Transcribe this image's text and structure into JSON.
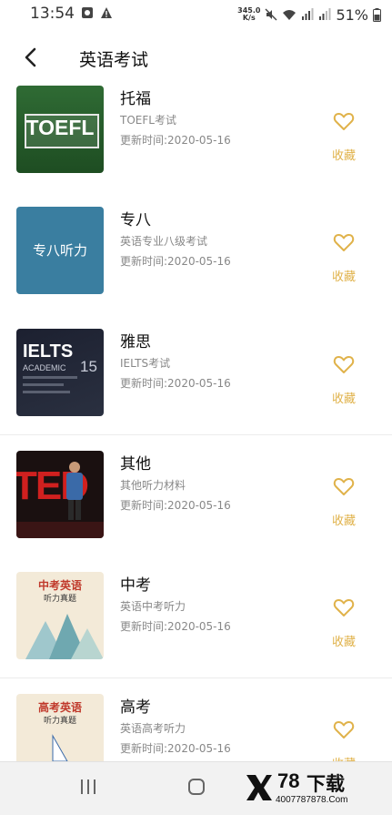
{
  "status_bar": {
    "time": "13:54",
    "net_speed_value": "345.0",
    "net_speed_unit": "K/s",
    "battery": "51%"
  },
  "header": {
    "title": "英语考试"
  },
  "items": [
    {
      "title": "托福",
      "desc": "TOEFL考试",
      "date": "更新时间:2020-05-16",
      "fav_label": "收藏",
      "thumb_text": "TOEFL"
    },
    {
      "title": "专八",
      "desc": "英语专业八级考试",
      "date": "更新时间:2020-05-16",
      "fav_label": "收藏",
      "thumb_text": "专八听力"
    },
    {
      "title": "雅思",
      "desc": "IELTS考试",
      "date": "更新时间:2020-05-16",
      "fav_label": "收藏",
      "thumb_text": "IELTS",
      "thumb_sub": "ACADEMIC",
      "thumb_num": "15"
    },
    {
      "title": "其他",
      "desc": "其他听力材料",
      "date": "更新时间:2020-05-16",
      "fav_label": "收藏",
      "thumb_text": "TED"
    },
    {
      "title": "中考",
      "desc": "英语中考听力",
      "date": "更新时间:2020-05-16",
      "fav_label": "收藏",
      "thumb_text": "中考英语",
      "thumb_sub": "听力真题"
    },
    {
      "title": "高考",
      "desc": "英语高考听力",
      "date": "更新时间:2020-05-16",
      "fav_label": "收藏",
      "thumb_text": "高考英语",
      "thumb_sub": "听力真题"
    }
  ],
  "watermark": {
    "number": "78",
    "word": "下载",
    "phone": "4007787878.Com"
  },
  "colors": {
    "accent": "#e0b24a",
    "divider": "#ececec"
  }
}
